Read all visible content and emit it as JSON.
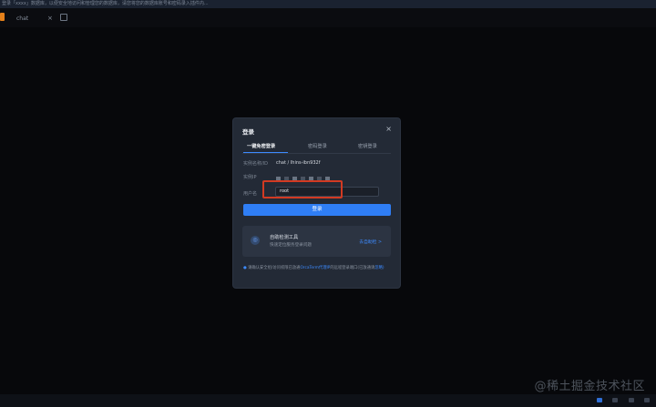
{
  "topbar": {
    "notice": "登录「xxxx」数据库，以便安全地访问和管理您的数据库，请您将您的数据库账号和密码录入插件内..."
  },
  "tabbar": {
    "tab_label": "chat",
    "close_symbol": "×"
  },
  "modal": {
    "title": "登录",
    "close_symbol": "×",
    "tabs": [
      "一键免密登录",
      "密码登录",
      "密钥登录"
    ],
    "active_tab": 0,
    "instance_label": "实例名称/ID",
    "instance_value": "chat / Ihins-ibn932f",
    "ip_label": "实例IP",
    "username_label": "用户名",
    "username_value": "root",
    "login_button": "登录",
    "tool": {
      "title": "自助检测工具",
      "description": "快速定位服务登录问题",
      "link": "去自助检 >"
    },
    "notice": {
      "prefix": "请确认安全组/访问权限已放通",
      "link1": "OrcaTerm代理IP",
      "middle": "的远程登录端口(已放通请",
      "link2": "忽略)"
    }
  },
  "watermark": "@稀土掘金技术社区",
  "colors": {
    "accent": "#2f7ef5",
    "highlight": "#d23a22",
    "background": "#0b0c10",
    "modal": "#232a36"
  }
}
